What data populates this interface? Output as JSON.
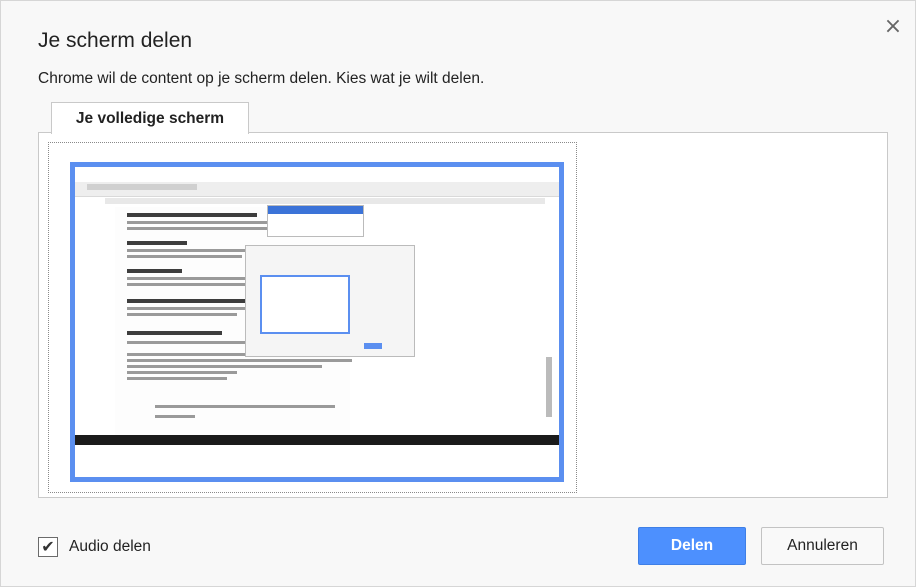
{
  "dialog": {
    "title": "Je scherm delen",
    "close_glyph": "×",
    "subtitle": "Chrome wil de content op je scherm delen. Kies wat je wilt delen."
  },
  "tabs": [
    {
      "label": "Je volledige scherm",
      "selected": true
    }
  ],
  "sources": [
    {
      "kind": "entire-screen",
      "selected": true,
      "selection_color": "#5b8ff0"
    }
  ],
  "audio": {
    "label": "Audio delen",
    "checked": true,
    "check_glyph": "✔"
  },
  "buttons": {
    "share_label": "Delen",
    "cancel_label": "Annuleren"
  },
  "colors": {
    "primary": "#4d90fe",
    "selection": "#5b8ff0",
    "dialog_bg": "#f8f8f8"
  }
}
